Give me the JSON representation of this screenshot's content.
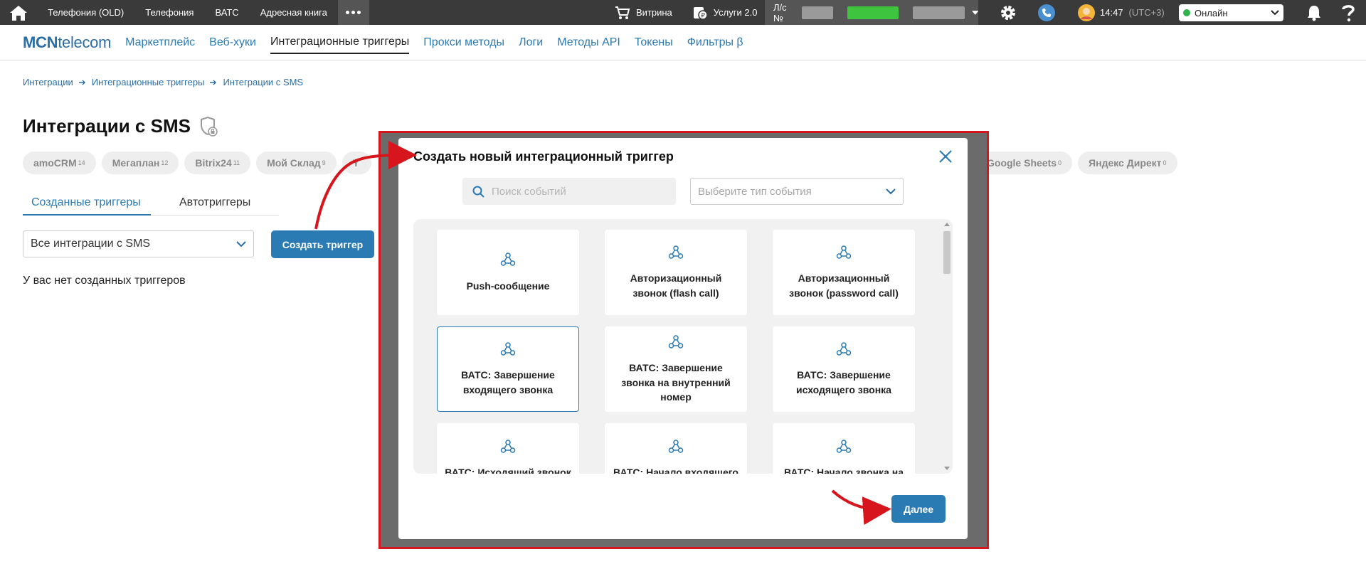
{
  "topbar": {
    "home_icon": "home-icon",
    "nav_items": [
      "Телефония (OLD)",
      "Телефония",
      "ВАТС",
      "Адресная книга"
    ],
    "more_icon": "more-dots-icon",
    "vitrina": "Витрина",
    "services": "Услуги 2.0",
    "account_label": "Л/с №",
    "time": "14:47",
    "timezone": "(UTC+3)",
    "status": "Онлайн",
    "status_color": "#2fb34a"
  },
  "subnav": {
    "logo_bold": "MCN",
    "logo_rest": "telecom",
    "items": [
      "Маркетплейс",
      "Веб-хуки",
      "Интеграционные триггеры",
      "Прокси методы",
      "Логи",
      "Методы API",
      "Токены",
      "Фильтры β"
    ],
    "active": "Интеграционные триггеры"
  },
  "breadcrumb": [
    "Интеграции",
    "Интеграционные триггеры",
    "Интеграции с SMS"
  ],
  "page": {
    "title": "Интеграции с SMS",
    "chips_left": [
      {
        "label": "amoCRM",
        "count": "14"
      },
      {
        "label": "Мегаплан",
        "count": "12"
      },
      {
        "label": "Bitrix24",
        "count": "11"
      },
      {
        "label": "Мой Склад",
        "count": "9"
      },
      {
        "label": "Y",
        "count": ""
      }
    ],
    "chips_right": [
      {
        "label": "Google Sheets",
        "count": "0"
      },
      {
        "label": "Яндекс Директ",
        "count": "0"
      }
    ],
    "tabs": [
      "Созданные триггеры",
      "Автотриггеры"
    ],
    "integration_select": "Все интеграции с SMS",
    "create_button": "Создать триггер",
    "empty_text": "У вас нет созданных триггеров"
  },
  "modal": {
    "title": "Создать новый интеграционный триггер",
    "search_placeholder": "Поиск событий",
    "type_placeholder": "Выберите тип события",
    "cards": [
      {
        "label": "Push-сообщение",
        "icon": "webhook-icon",
        "selected": false
      },
      {
        "label": "Авторизационный звонок (flash call)",
        "icon": "webhook-icon",
        "selected": false
      },
      {
        "label": "Авторизационный звонок (password call)",
        "icon": "webhook-icon",
        "selected": false
      },
      {
        "label": "ВАТС: Завершение входящего звонка",
        "icon": "webhook-icon",
        "selected": true
      },
      {
        "label": "ВАТС: Завершение звонка на внутренний номер",
        "icon": "webhook-icon",
        "selected": false
      },
      {
        "label": "ВАТС: Завершение исходящего звонка",
        "icon": "webhook-icon",
        "selected": false
      },
      {
        "label": "ВАТС: Исходящий звонок",
        "icon": "webhook-icon",
        "selected": false
      },
      {
        "label": "ВАТС: Начало входящего",
        "icon": "webhook-icon",
        "selected": false
      },
      {
        "label": "ВАТС: Начало звонка на",
        "icon": "webhook-icon",
        "selected": false
      }
    ],
    "next_button": "Далее"
  },
  "colors": {
    "accent": "#2a7ab4",
    "topbar": "#3a3a3a",
    "highlight_frame": "#d6151c"
  }
}
